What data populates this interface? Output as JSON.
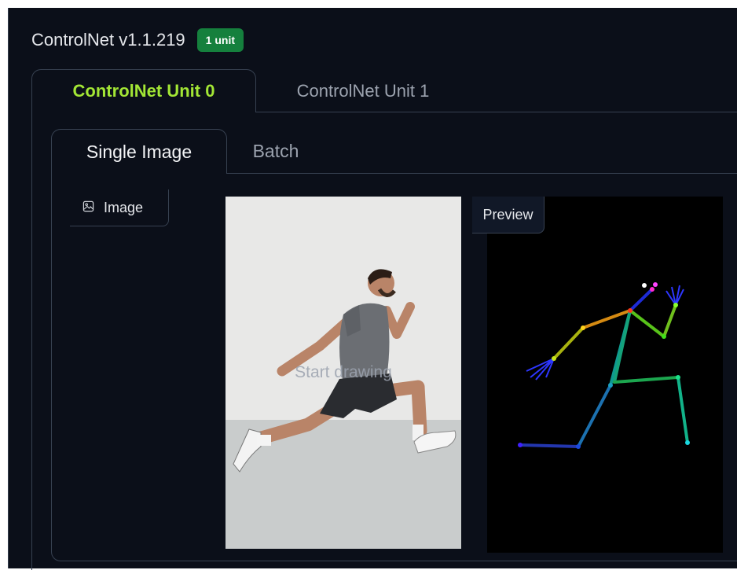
{
  "header": {
    "title": "ControlNet v1.1.219",
    "badge": "1 unit"
  },
  "unit_tabs": [
    {
      "label": "ControlNet Unit 0",
      "active": true
    },
    {
      "label": "ControlNet Unit 1",
      "active": false
    }
  ],
  "mode_tabs": [
    {
      "label": "Single Image",
      "active": true
    },
    {
      "label": "Batch",
      "active": false
    }
  ],
  "image_panel": {
    "label": "Image",
    "icon": "image-icon",
    "placeholder": "Start drawing"
  },
  "preview_panel": {
    "label": "Preview"
  },
  "colors": {
    "background": "#0b0f19",
    "active_tab": "#a3e635",
    "badge": "#15803d",
    "border": "#374151"
  }
}
